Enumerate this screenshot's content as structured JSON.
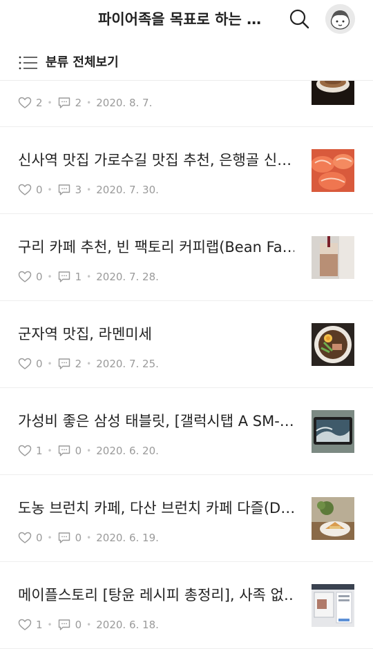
{
  "header": {
    "blog_title": "파이어족을 목표로 하는 …"
  },
  "category_bar": {
    "label": "분류 전체보기"
  },
  "icons": {
    "search": "search-icon",
    "menu": "list-icon",
    "like": "heart-icon",
    "comment": "comment-icon"
  },
  "posts": [
    {
      "title": "",
      "likes": "2",
      "comments": "2",
      "date": "2020. 8. 7."
    },
    {
      "title": "신사역 맛집 가로수길 맛집 추천, 은행골 신…",
      "likes": "0",
      "comments": "3",
      "date": "2020. 7. 30."
    },
    {
      "title": "구리 카페 추천, 빈 팩토리 커피랩(Bean Fa…",
      "likes": "0",
      "comments": "1",
      "date": "2020. 7. 28."
    },
    {
      "title": "군자역 맛집, 라멘미세",
      "likes": "0",
      "comments": "2",
      "date": "2020. 7. 25."
    },
    {
      "title": "가성비 좋은 삼성 태블릿, [갤럭시탭 A SM-…",
      "likes": "1",
      "comments": "0",
      "date": "2020. 6. 20."
    },
    {
      "title": "도농 브런치 카페, 다산 브런치 카페 다즐(D…",
      "likes": "0",
      "comments": "0",
      "date": "2020. 6. 19."
    },
    {
      "title": "메이플스토리 [탕윤 레시피 총정리], 사족 없…",
      "likes": "1",
      "comments": "0",
      "date": "2020. 6. 18."
    }
  ]
}
